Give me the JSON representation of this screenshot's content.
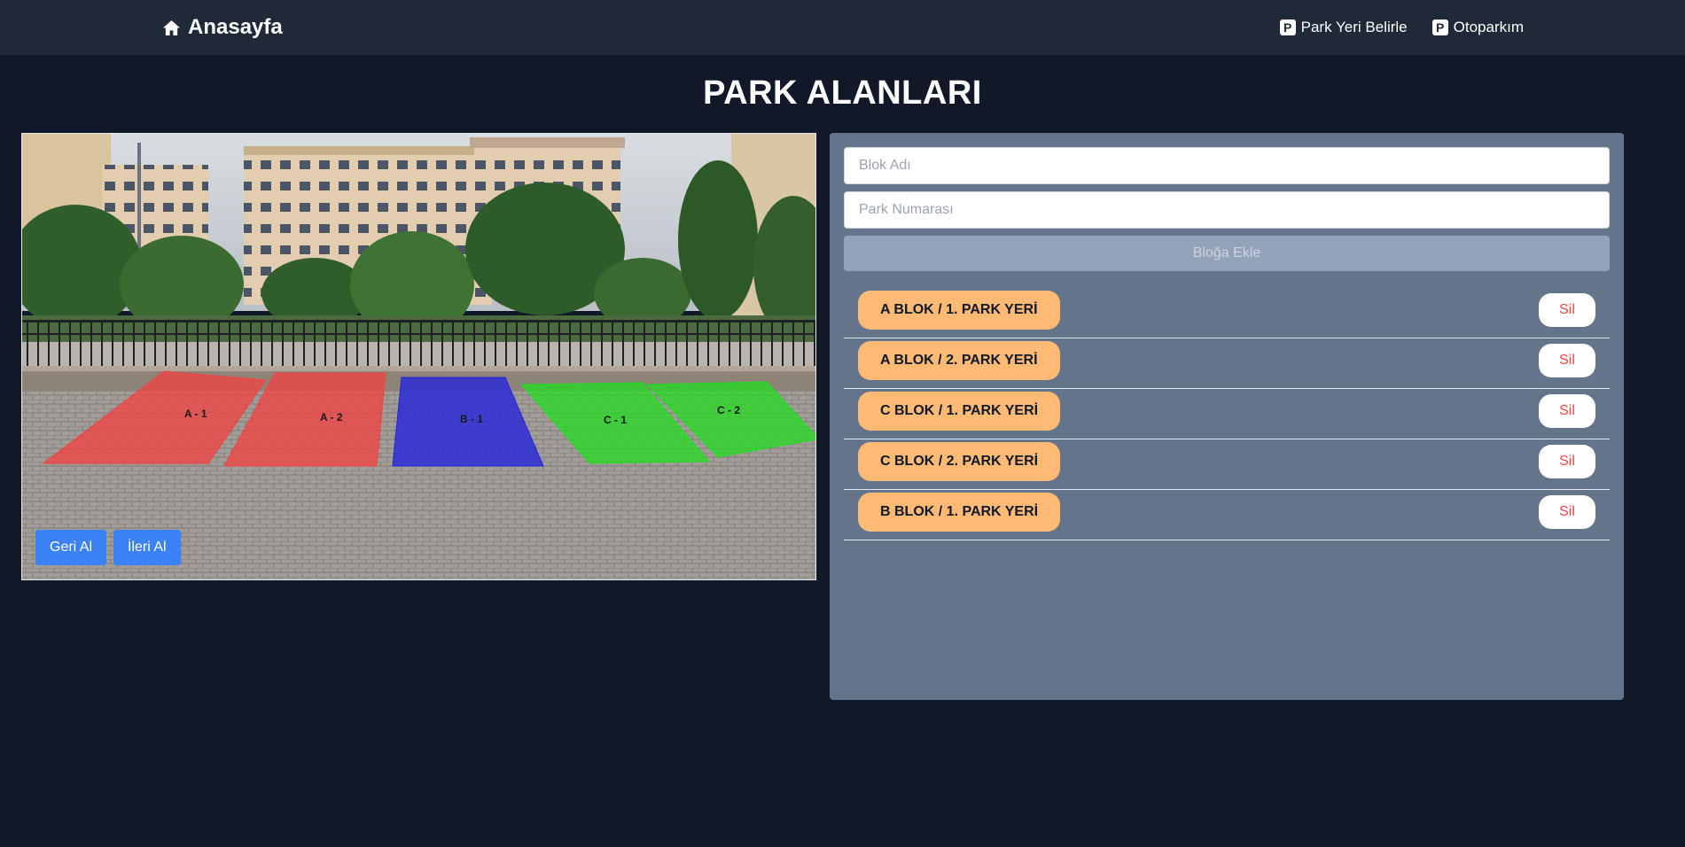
{
  "nav": {
    "brand_label": "Anasayfa",
    "links": [
      {
        "label": "Park Yeri Belirle",
        "icon": "parking-icon"
      },
      {
        "label": "Otoparkım",
        "icon": "parking-icon"
      }
    ]
  },
  "page": {
    "title": "PARK ALANLARI"
  },
  "image": {
    "zones": [
      {
        "label": "A - 1",
        "color": "#ef4444"
      },
      {
        "label": "A - 2",
        "color": "#ef4444"
      },
      {
        "label": "B - 1",
        "color": "#2222dd"
      },
      {
        "label": "C - 1",
        "color": "#22dd22"
      },
      {
        "label": "C - 2",
        "color": "#22dd22"
      }
    ],
    "undo_label": "Geri Al",
    "redo_label": "İleri Al"
  },
  "form": {
    "block_placeholder": "Blok Adı",
    "park_number_placeholder": "Park Numarası",
    "add_button_label": "Bloğa Ekle"
  },
  "spots": [
    {
      "label": "A BLOK / 1. PARK YERİ",
      "delete_label": "Sil"
    },
    {
      "label": "A BLOK / 2. PARK YERİ",
      "delete_label": "Sil"
    },
    {
      "label": "C BLOK / 1. PARK YERİ",
      "delete_label": "Sil"
    },
    {
      "label": "C BLOK / 2. PARK YERİ",
      "delete_label": "Sil"
    },
    {
      "label": "B BLOK / 1. PARK YERİ",
      "delete_label": "Sil"
    }
  ],
  "colors": {
    "background": "#111827",
    "navbar": "#1f2937",
    "panel": "#64748b",
    "pill": "#fdba74",
    "primary_button": "#3b82f6",
    "delete_text": "#ef4444"
  }
}
